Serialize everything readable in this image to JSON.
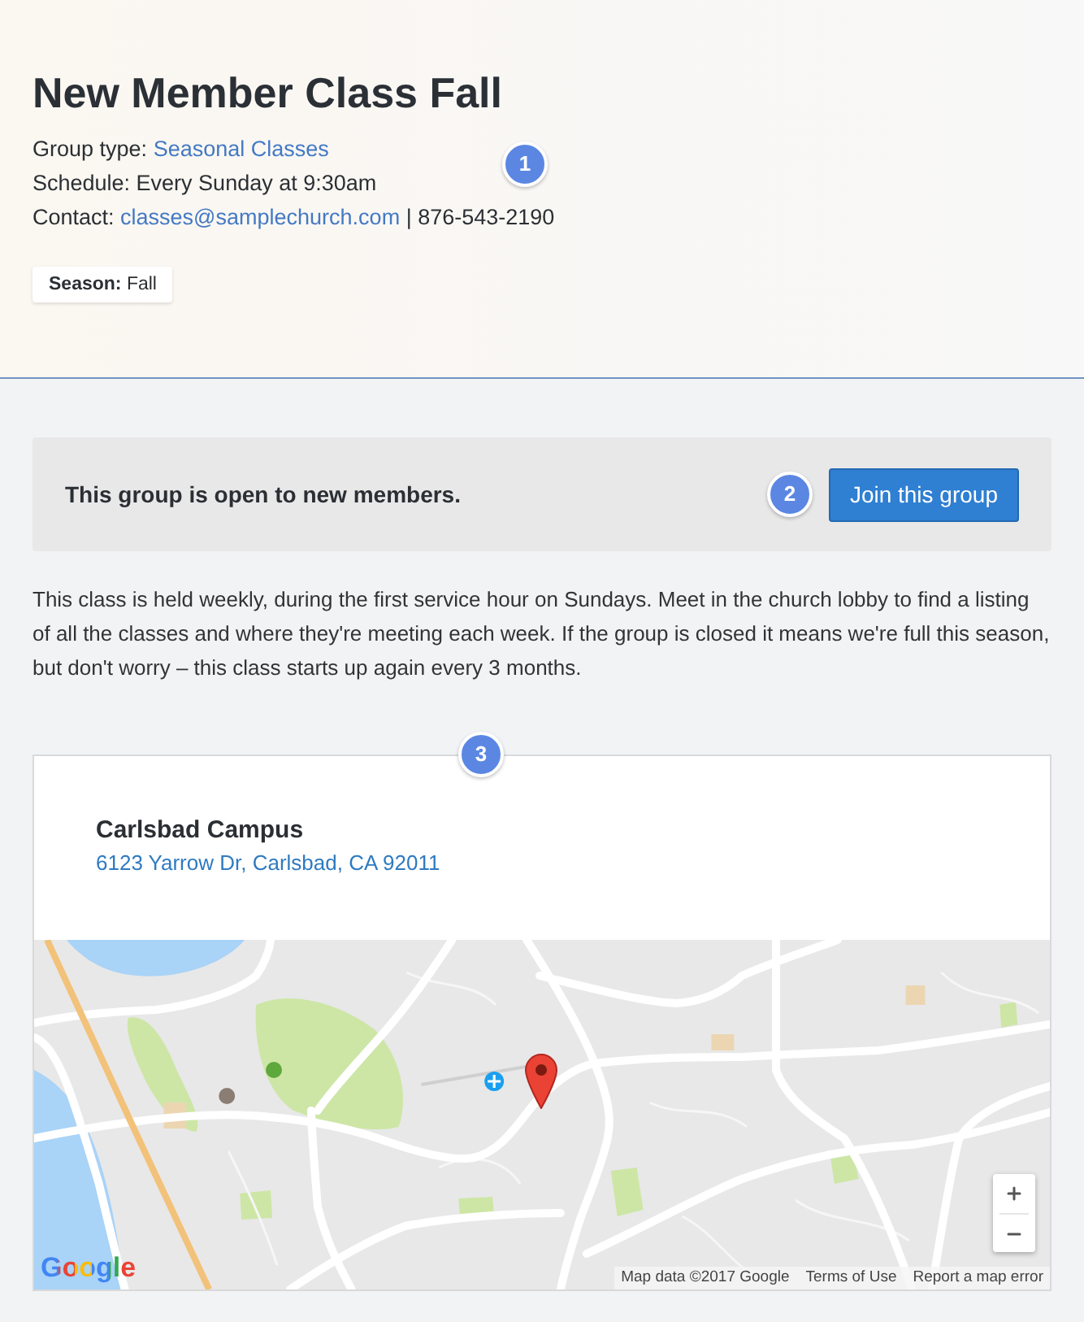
{
  "header": {
    "title": "New Member Class Fall",
    "marker": "1",
    "details": [
      {
        "label": "Group type:",
        "link": "Seasonal Classes"
      },
      {
        "label": "Schedule:",
        "value": "Every Sunday at 9:30am"
      },
      {
        "label": "Contact:",
        "link": "classes@samplechurch.com",
        "value": "| 876-543-2190"
      }
    ],
    "tags": [
      "**Season:** Fall"
    ]
  },
  "banner": {
    "message": "This group is open to new members.",
    "marker": "2",
    "button": "Join this group"
  },
  "description": "This class is held weekly, during the first service hour on Sundays. Meet in the church lobby to find a listing of all the classes and where they're meeting each week. If the group is closed it means we're full this season, but don't worry – this class starts up again every 3 months.",
  "location": {
    "marker": "3",
    "name": "Carlsbad Campus",
    "address": "6123 Yarrow Dr, Carlsbad, CA 92011",
    "map": {
      "logo": "Google",
      "attribution": [
        "Map data ©2017 Google",
        "Terms of Use",
        "Report a map error"
      ]
    }
  }
}
